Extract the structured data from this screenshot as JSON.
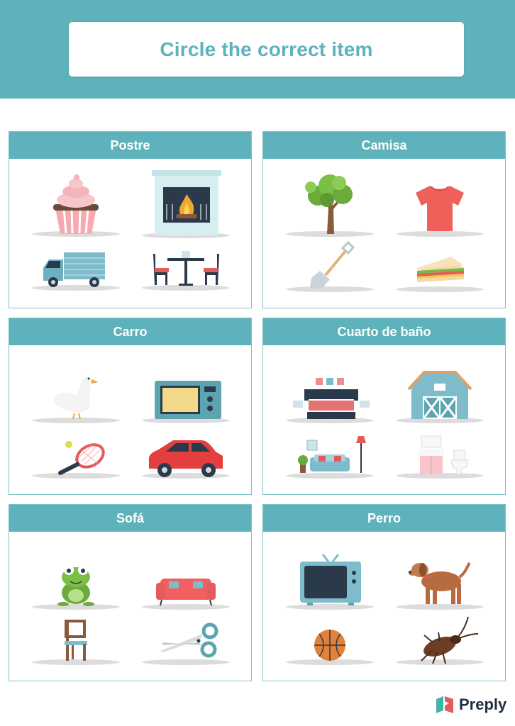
{
  "header": {
    "title": "Circle the correct item"
  },
  "cards": [
    {
      "title": "Postre",
      "items": [
        "cupcake-icon",
        "fireplace-icon",
        "truck-icon",
        "dining-table-icon"
      ]
    },
    {
      "title": "Camisa",
      "items": [
        "tree-icon",
        "tshirt-icon",
        "shovel-icon",
        "sandwich-icon"
      ]
    },
    {
      "title": "Carro",
      "items": [
        "goose-icon",
        "microwave-icon",
        "tennis-racket-icon",
        "car-icon"
      ]
    },
    {
      "title": "Cuarto de baño",
      "items": [
        "bedroom-icon",
        "barn-icon",
        "living-room-icon",
        "bathroom-icon"
      ]
    },
    {
      "title": "Sofá",
      "items": [
        "frog-icon",
        "sofa-icon",
        "chair-icon",
        "scissors-icon"
      ]
    },
    {
      "title": "Perro",
      "items": [
        "tv-icon",
        "dog-icon",
        "basketball-icon",
        "cockroach-icon"
      ]
    }
  ],
  "brand": {
    "name": "Preply"
  },
  "colors": {
    "accent": "#5eb2bb",
    "border": "#7cc1c9",
    "shadow": "#dcdcdc"
  }
}
